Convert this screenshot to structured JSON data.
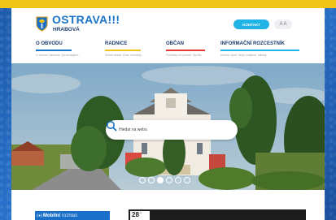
{
  "header": {
    "logo_title": "OSTRAVA!!!",
    "logo_subtitle": "HRABOVÁ",
    "contact_button": "KONTAKT",
    "font_size_button": "A A"
  },
  "nav": {
    "items": [
      {
        "label": "O OBVODU",
        "description": "O obvodu, Aktuálně, Zpravodajství...",
        "underline_color": "#1a74c9"
      },
      {
        "label": "RADNICE",
        "description": "Úřední deska, Úřad, Kontakty...",
        "underline_color": "#f0c419"
      },
      {
        "label": "OBČAN",
        "description": "Podklady ve vyřízení, Služby...",
        "underline_color": "#e53935"
      },
      {
        "label": "INFORMAČNÍ ROZCESTNÍK",
        "description": "Kultura, sport, školy, instituce, odkazy...",
        "underline_color": "#22b3e6"
      }
    ]
  },
  "hero": {
    "search_placeholder": "Hledat na webu",
    "slide_count": 6,
    "active_slide": 3
  },
  "bottom": {
    "mobile_banner_bold": "Mobilní",
    "mobile_banner_light": "rozhlas",
    "event_day": "28",
    "event_month": "st."
  },
  "colors": {
    "brand_blue": "#1a74c9",
    "accent_yellow": "#f0c419",
    "accent_cyan": "#22b3e6",
    "frame_blue": "#1f5fb4"
  }
}
